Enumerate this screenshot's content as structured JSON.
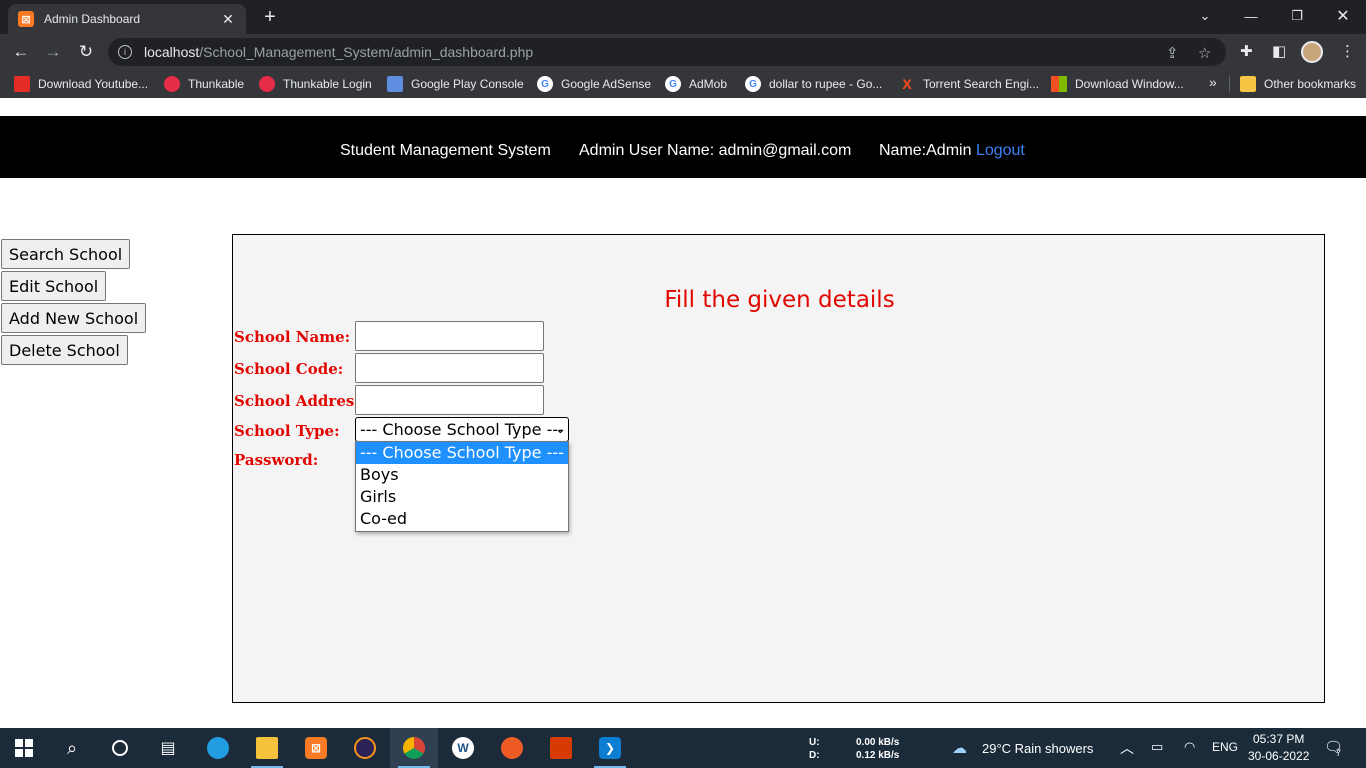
{
  "browser": {
    "tab_title": "Admin Dashboard",
    "tab_favicon": "xampp-icon",
    "new_tab": "+",
    "url_host": "localhost",
    "url_path": "/School_Management_System/admin_dashboard.php",
    "bookmarks": [
      {
        "label": "Download Youtube...",
        "icon": "youtube-downloader-icon",
        "color": "#e52d27"
      },
      {
        "label": "Thunkable",
        "icon": "thunkable-icon",
        "color": "#e52d47"
      },
      {
        "label": "Thunkable Login",
        "icon": "thunkable-icon",
        "color": "#e52d47"
      },
      {
        "label": "Google Play Console",
        "icon": "play-console-icon",
        "color": "#5f8de0"
      },
      {
        "label": "Google AdSense",
        "icon": "google-icon",
        "color": "#ffffff"
      },
      {
        "label": "AdMob",
        "icon": "google-icon",
        "color": "#ffffff"
      },
      {
        "label": "dollar to rupee - Go...",
        "icon": "google-icon",
        "color": "#ffffff"
      },
      {
        "label": "Torrent Search Engi...",
        "icon": "torrent-icon",
        "color": "#ff4a1c"
      },
      {
        "label": "Download Window...",
        "icon": "windows-icon",
        "color": "#f25022"
      }
    ],
    "bookmarks_more": "»",
    "other_bookmarks": "Other bookmarks"
  },
  "header": {
    "app_name": "Student Management System",
    "admin_user": "Admin User Name: admin@gmail.com",
    "name": "Name:Admin",
    "logout": "Logout"
  },
  "sidebar": {
    "buttons": [
      "Search School",
      "Edit School",
      "Add New School",
      "Delete School"
    ]
  },
  "form": {
    "title": "Fill the given details",
    "labels": {
      "school_name": "School Name:",
      "school_code": "School Code:",
      "school_address": "School Address:",
      "school_type": "School Type:",
      "password": "Password:"
    },
    "values": {
      "school_name": "",
      "school_code": "",
      "school_address": ""
    },
    "school_type_selected": "--- Choose School Type ---",
    "school_type_options": [
      "--- Choose School Type ---",
      "Boys",
      "Girls",
      "Co-ed"
    ]
  },
  "taskbar": {
    "net_upload_label": "U:",
    "net_download_label": "D:",
    "net_upload": "0.00 kB/s",
    "net_download": "0.12 kB/s",
    "weather": "29°C  Rain showers",
    "language": "ENG",
    "time": "05:37 PM",
    "date": "30-06-2022",
    "notifications": "7"
  },
  "colors": {
    "accent_red": "#e10600",
    "link_blue": "#3b82f6",
    "selected_option": "#1e90ff"
  }
}
